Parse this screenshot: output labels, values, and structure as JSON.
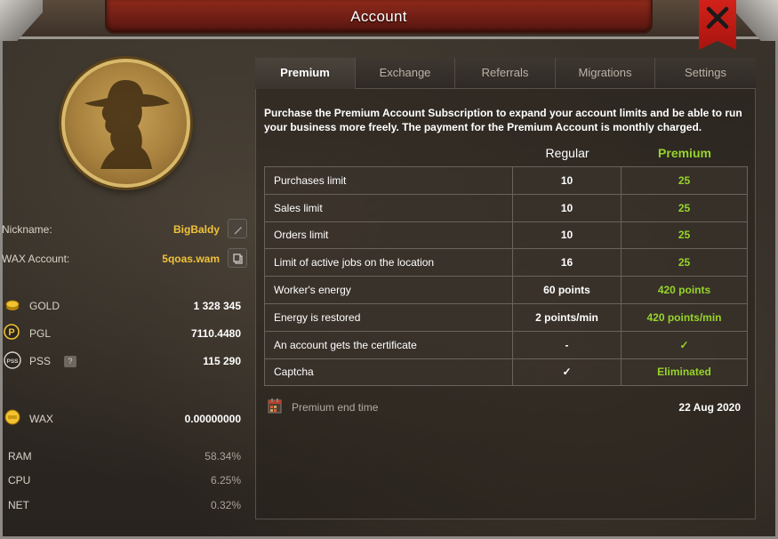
{
  "window": {
    "title": "Account"
  },
  "profile": {
    "nickname_label": "Nickname:",
    "nickname_value": "BigBaldy",
    "wax_account_label": "WAX Account:",
    "wax_account_value": "5qoas.wam"
  },
  "currencies": [
    {
      "name": "GOLD",
      "value": "1 328 345",
      "icon": "gold-coin-icon"
    },
    {
      "name": "PGL",
      "value": "7110.4480",
      "icon": "pgl-coin-icon"
    },
    {
      "name": "PSS",
      "value": "115 290",
      "icon": "pss-coin-icon",
      "help": "?"
    },
    {
      "name": "WAX",
      "value": "0.00000000",
      "icon": "wax-coin-icon"
    }
  ],
  "resources": [
    {
      "name": "RAM",
      "value": "58.34%"
    },
    {
      "name": "CPU",
      "value": "6.25%"
    },
    {
      "name": "NET",
      "value": "0.32%"
    }
  ],
  "tabs": [
    {
      "label": "Premium",
      "active": true
    },
    {
      "label": "Exchange",
      "active": false
    },
    {
      "label": "Referrals",
      "active": false
    },
    {
      "label": "Migrations",
      "active": false
    },
    {
      "label": "Settings",
      "active": false
    }
  ],
  "premium": {
    "description": "Purchase the Premium Account Subscription to expand your account limits and be able to run your business more freely. The payment for the Premium Account is monthly charged.",
    "col_regular": "Regular",
    "col_premium": "Premium",
    "rows": [
      {
        "label": "Purchases limit",
        "regular": "10",
        "premium": "25"
      },
      {
        "label": "Sales limit",
        "regular": "10",
        "premium": "25"
      },
      {
        "label": "Orders limit",
        "regular": "10",
        "premium": "25"
      },
      {
        "label": "Limit of active jobs on the location",
        "regular": "16",
        "premium": "25"
      },
      {
        "label": "Worker's energy",
        "regular": "60 points",
        "premium": "420 points"
      },
      {
        "label": "Energy is restored",
        "regular": "2 points/min",
        "premium": "420 points/min"
      },
      {
        "label": "An account gets the certificate",
        "regular": "-",
        "premium": "✓"
      },
      {
        "label": "Captcha",
        "regular": "✓",
        "premium": "Eliminated"
      }
    ],
    "end_time_label": "Premium end time",
    "end_time_value": "22 Aug 2020"
  },
  "colors": {
    "accent_gold": "#f0c23a",
    "premium_green": "#97d42a",
    "title_red": "#8e2a1c",
    "close_red": "#d1221a"
  }
}
